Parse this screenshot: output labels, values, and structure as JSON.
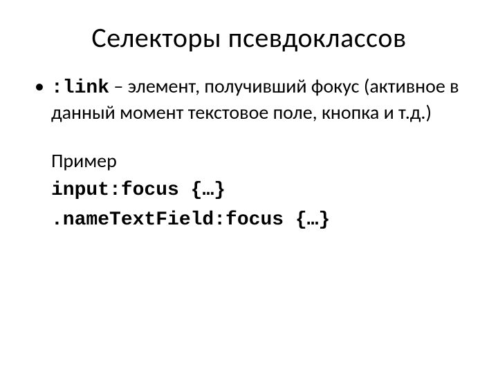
{
  "title": "Селекторы псевдоклассов",
  "bullet": {
    "marker": "•",
    "selector": ":link",
    "dash": "–",
    "description": "элемент, получивший фокус (активное в данный момент текстовое поле, кнопка и т.д.)"
  },
  "example_label": "Пример",
  "examples": {
    "line1_code": "input:focus",
    "line1_tail": " {…}",
    "line2_code": ".nameTextField:focus",
    "line2_tail": " {…}"
  }
}
